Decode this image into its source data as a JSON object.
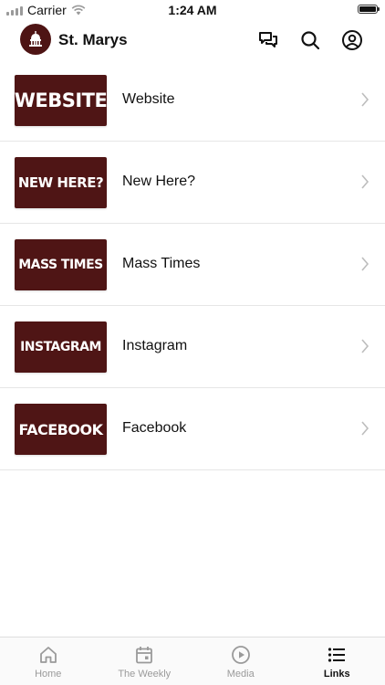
{
  "status_bar": {
    "carrier": "Carrier",
    "time": "1:24 AM"
  },
  "header": {
    "title": "St. Marys",
    "icons": [
      "chat-icon",
      "search-icon",
      "account-icon"
    ]
  },
  "links": [
    {
      "tile_text": "WEBSITE",
      "label": "Website"
    },
    {
      "tile_text": "NEW HERE?",
      "label": "New Here?"
    },
    {
      "tile_text": "MASS TIMES",
      "label": "Mass Times"
    },
    {
      "tile_text": "INSTAGRAM",
      "label": "Instagram"
    },
    {
      "tile_text": "FACEBOOK",
      "label": "Facebook"
    }
  ],
  "tabs": [
    {
      "label": "Home",
      "icon": "home-icon",
      "active": false
    },
    {
      "label": "The Weekly",
      "icon": "calendar-icon",
      "active": false
    },
    {
      "label": "Media",
      "icon": "play-icon",
      "active": false
    },
    {
      "label": "Links",
      "icon": "list-icon",
      "active": true
    }
  ],
  "colors": {
    "tile_background": "#4f1515",
    "active_tab": "#111111",
    "inactive_tab": "#9a9a9a"
  }
}
